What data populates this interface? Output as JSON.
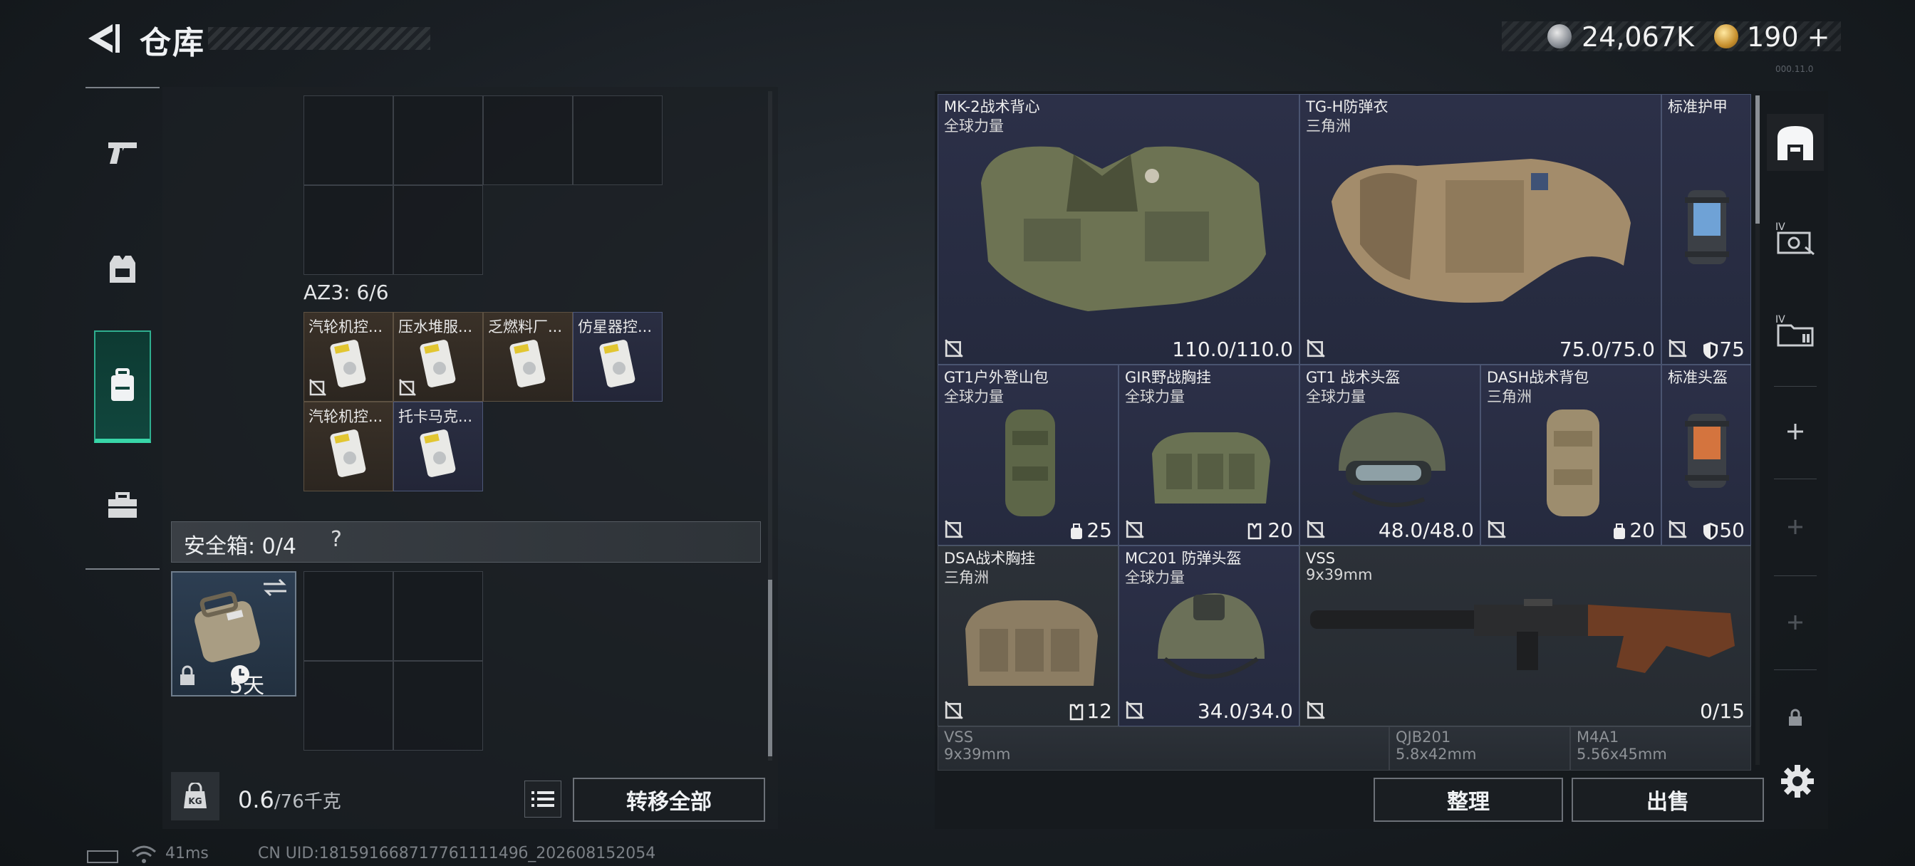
{
  "header": {
    "title": "仓库",
    "currency_silver": "24,067K",
    "currency_gold": "190",
    "gold_plus": "+",
    "version": "000.11.0"
  },
  "sidebar": {
    "tabs": [
      {
        "name": "weapons",
        "icon": "pistol-icon"
      },
      {
        "name": "gear",
        "icon": "vest-icon"
      },
      {
        "name": "backpack",
        "icon": "backpack-icon",
        "active": true
      },
      {
        "name": "supplies",
        "icon": "briefcase-icon"
      }
    ]
  },
  "container": {
    "label": "AZ3: 6/6",
    "items": [
      {
        "name": "汽轮机控...",
        "bg": "brown",
        "uninsured": true
      },
      {
        "name": "压水堆服...",
        "bg": "brown",
        "uninsured": true
      },
      {
        "name": "乏燃料厂...",
        "bg": "brown",
        "uninsured": false
      },
      {
        "name": "仿星器控...",
        "bg": "blue",
        "uninsured": false
      },
      {
        "name": "汽轮机控...",
        "bg": "brown",
        "uninsured": false
      },
      {
        "name": "托卡马克...",
        "bg": "blue",
        "uninsured": false
      }
    ]
  },
  "safebox": {
    "label": "安全箱: 0/4",
    "help": "?",
    "timer": "5天"
  },
  "weight": {
    "current": "0.6",
    "max": "/76千克"
  },
  "buttons": {
    "transfer_all": "转移全部",
    "sort": "整理",
    "sell": "出售"
  },
  "warehouse": {
    "items": [
      {
        "id": "mk2",
        "name": "MK-2战术背心",
        "sub": "全球力量",
        "value": "110.0/110.0"
      },
      {
        "id": "tgh",
        "name": "TG-H防弹衣",
        "sub": "三角洲",
        "value": "75.0/75.0"
      },
      {
        "id": "armor-std",
        "name": "标准护甲",
        "sub": "",
        "value": "75"
      },
      {
        "id": "gt1-pack",
        "name": "GT1户外登山包",
        "sub": "全球力量",
        "value": "25"
      },
      {
        "id": "gir",
        "name": "GIR野战胸挂",
        "sub": "全球力量",
        "value": "20"
      },
      {
        "id": "gt1-helmet",
        "name": "GT1 战术头盔",
        "sub": "全球力量",
        "value": "48.0/48.0"
      },
      {
        "id": "dash",
        "name": "DASH战术背包",
        "sub": "三角洲",
        "value": "20"
      },
      {
        "id": "helmet-std",
        "name": "标准头盔",
        "sub": "",
        "value": "50"
      },
      {
        "id": "dsa",
        "name": "DSA战术胸挂",
        "sub": "三角洲",
        "value": "12"
      },
      {
        "id": "mc201",
        "name": "MC201 防弹头盔",
        "sub": "全球力量",
        "value": "34.0/34.0"
      },
      {
        "id": "vss",
        "name": "VSS",
        "sub": "9x39mm",
        "value": "0/15"
      }
    ],
    "peek": [
      {
        "name": "VSS",
        "sub": "9x39mm"
      },
      {
        "name": "QJB201",
        "sub": "5.8x42mm"
      },
      {
        "name": "M4A1",
        "sub": "5.56x45mm"
      }
    ]
  },
  "status": {
    "ping": "41ms",
    "uid": "CN UID:18159166871776111149б_202608152054"
  }
}
